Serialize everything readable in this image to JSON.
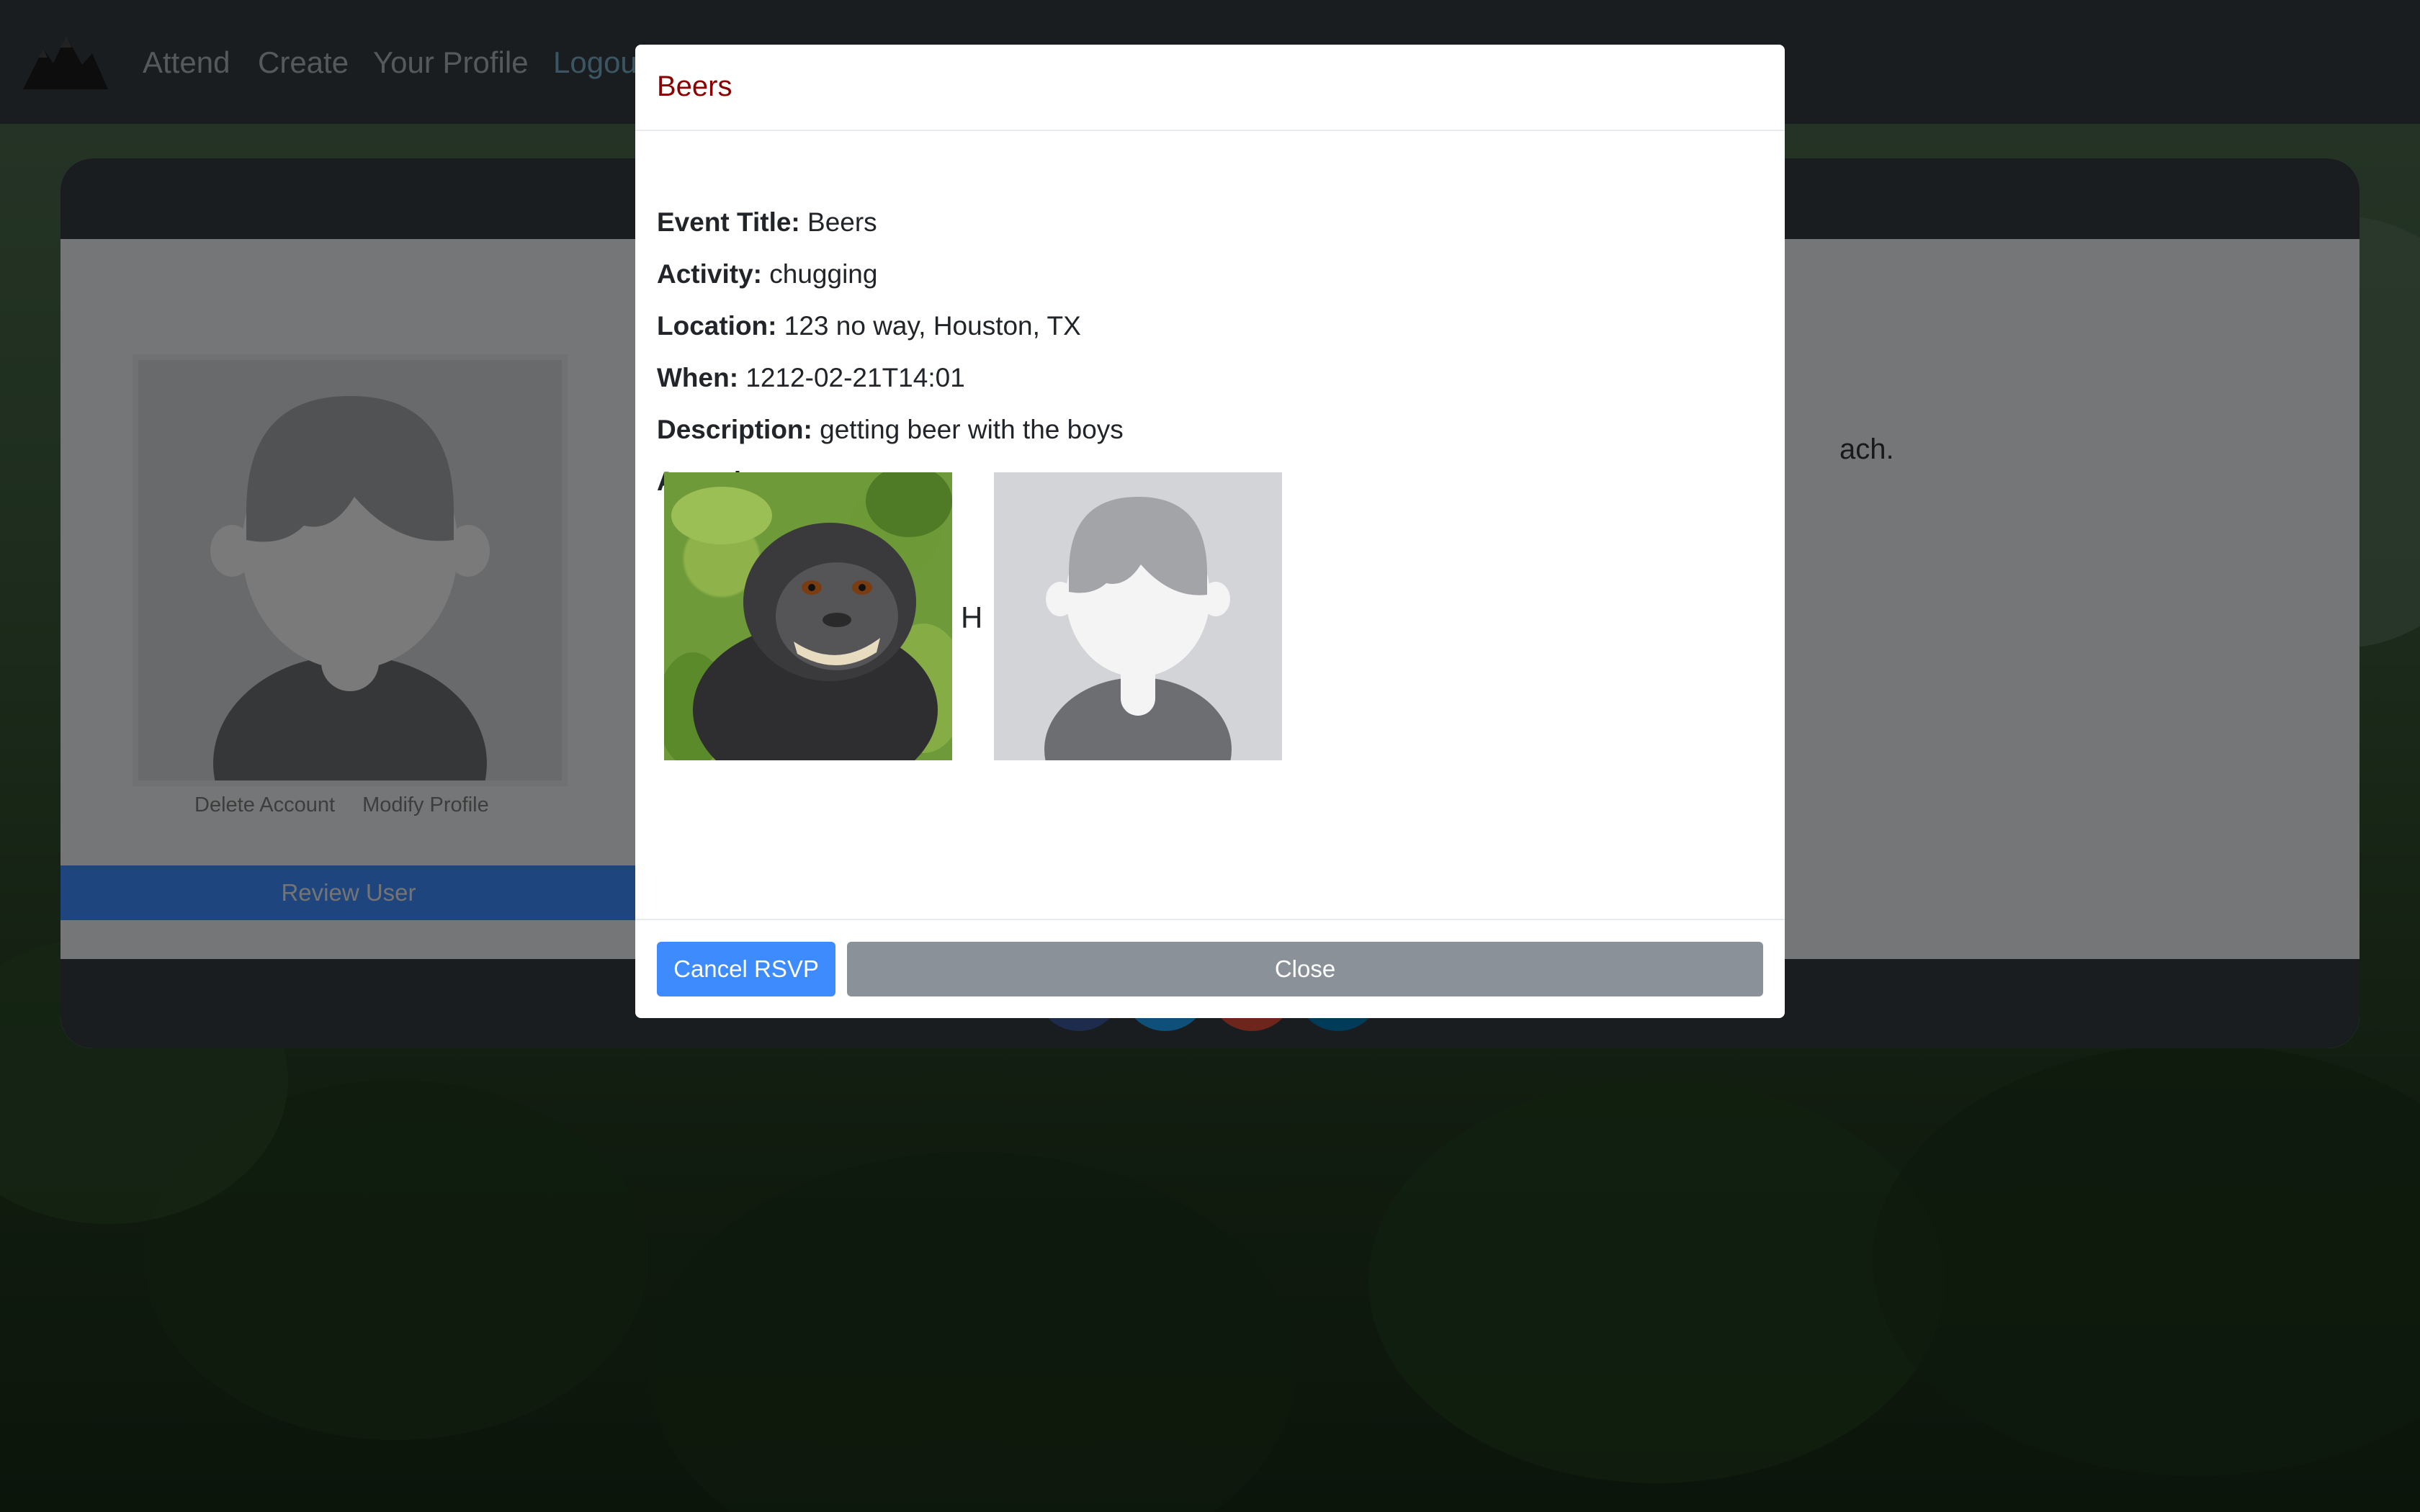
{
  "navbar": {
    "brand_icon": "mountains-icon",
    "links": [
      "Attend",
      "Create",
      "Your Profile",
      "Logout"
    ]
  },
  "profile": {
    "delete_account": "Delete Account",
    "modify_profile": "Modify Profile",
    "review_user": "Review User",
    "about_fragment": "ach."
  },
  "modal": {
    "title": "Beers",
    "fields": [
      {
        "label": "Event Title:",
        "value": "Beers"
      },
      {
        "label": "Activity:",
        "value": "chugging"
      },
      {
        "label": "Location:",
        "value": "123 no way, Houston, TX"
      },
      {
        "label": "When:",
        "value": "1212-02-21T14:01"
      },
      {
        "label": "Description:",
        "value": "getting beer with the boys"
      }
    ],
    "attendees_label": "Attendees:",
    "attendees": [
      {
        "name": "H",
        "avatar": "monkey-photo"
      },
      {
        "name": "",
        "avatar": "default-avatar"
      }
    ],
    "cancel_rsvp": "Cancel RSVP",
    "close": "Close"
  },
  "colors": {
    "navbar": "#343a40",
    "primary": "#3d8bfd",
    "secondary": "#8a9199",
    "modal_title": "#8b0000"
  }
}
